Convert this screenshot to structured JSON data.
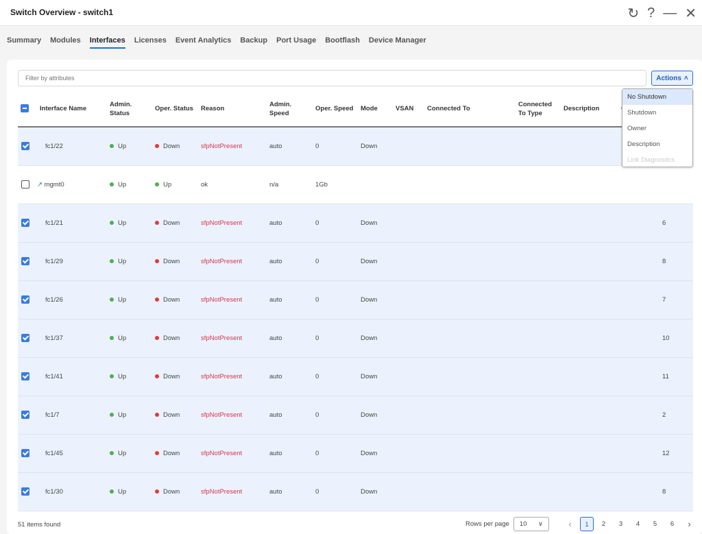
{
  "window": {
    "title": "Switch Overview - switch1",
    "icons": [
      "refresh-icon",
      "help-icon",
      "minimize-icon",
      "close-icon"
    ]
  },
  "tabs": [
    {
      "label": "Summary"
    },
    {
      "label": "Modules"
    },
    {
      "label": "Interfaces",
      "active": true
    },
    {
      "label": "Licenses"
    },
    {
      "label": "Event Analytics"
    },
    {
      "label": "Backup"
    },
    {
      "label": "Port Usage"
    },
    {
      "label": "Bootflash"
    },
    {
      "label": "Device Manager"
    }
  ],
  "filter": {
    "placeholder": "Filter by attributes"
  },
  "actions": {
    "label": "Actions",
    "menu": [
      {
        "label": "No Shutdown",
        "highlighted": true
      },
      {
        "label": "Shutdown"
      },
      {
        "label": "Owner"
      },
      {
        "label": "Description"
      },
      {
        "label": "Link Diagnostics",
        "disabled": true
      }
    ]
  },
  "table": {
    "headers": [
      "Interface Name",
      "Admin. Status",
      "Oper. Status",
      "Reason",
      "Admin. Speed",
      "Oper. Speed",
      "Mode",
      "VSAN",
      "Connected To",
      "Connected To Type",
      "Description",
      "Owner",
      ""
    ],
    "rows": [
      {
        "selected": true,
        "name": "fc1/22",
        "admin": "Up",
        "oper": "Down",
        "reason": "sfpNotPresent",
        "aspeed": "auto",
        "ospeed": "0",
        "mode": "Down",
        "last": ""
      },
      {
        "selected": false,
        "name": "mgmt0",
        "icon": "trend-icon",
        "admin": "Up",
        "oper": "Up",
        "reason": "ok",
        "aspeed": "n/a",
        "ospeed": "1Gb",
        "mode": "",
        "last": ""
      },
      {
        "selected": true,
        "name": "fc1/21",
        "admin": "Up",
        "oper": "Down",
        "reason": "sfpNotPresent",
        "aspeed": "auto",
        "ospeed": "0",
        "mode": "Down",
        "last": "6"
      },
      {
        "selected": true,
        "name": "fc1/29",
        "admin": "Up",
        "oper": "Down",
        "reason": "sfpNotPresent",
        "aspeed": "auto",
        "ospeed": "0",
        "mode": "Down",
        "last": "8"
      },
      {
        "selected": true,
        "name": "fc1/26",
        "admin": "Up",
        "oper": "Down",
        "reason": "sfpNotPresent",
        "aspeed": "auto",
        "ospeed": "0",
        "mode": "Down",
        "last": "7"
      },
      {
        "selected": true,
        "name": "fc1/37",
        "admin": "Up",
        "oper": "Down",
        "reason": "sfpNotPresent",
        "aspeed": "auto",
        "ospeed": "0",
        "mode": "Down",
        "last": "10"
      },
      {
        "selected": true,
        "name": "fc1/41",
        "admin": "Up",
        "oper": "Down",
        "reason": "sfpNotPresent",
        "aspeed": "auto",
        "ospeed": "0",
        "mode": "Down",
        "last": "11"
      },
      {
        "selected": true,
        "name": "fc1/7",
        "admin": "Up",
        "oper": "Down",
        "reason": "sfpNotPresent",
        "aspeed": "auto",
        "ospeed": "0",
        "mode": "Down",
        "last": "2"
      },
      {
        "selected": true,
        "name": "fc1/45",
        "admin": "Up",
        "oper": "Down",
        "reason": "sfpNotPresent",
        "aspeed": "auto",
        "ospeed": "0",
        "mode": "Down",
        "last": "12"
      },
      {
        "selected": true,
        "name": "fc1/30",
        "admin": "Up",
        "oper": "Down",
        "reason": "sfpNotPresent",
        "aspeed": "auto",
        "ospeed": "0",
        "mode": "Down",
        "last": "8"
      }
    ]
  },
  "footer": {
    "count": "51 items found",
    "rows_per_page_label": "Rows per page",
    "rows_per_page": "10",
    "pages": [
      "1",
      "2",
      "3",
      "4",
      "5",
      "6"
    ],
    "current_page": "1"
  },
  "colors": {
    "accent": "#1f6fd1",
    "up": "#4caf50",
    "down": "#e53935",
    "reason_down": "#d9344a",
    "selected_row": "#ebf2fd"
  }
}
